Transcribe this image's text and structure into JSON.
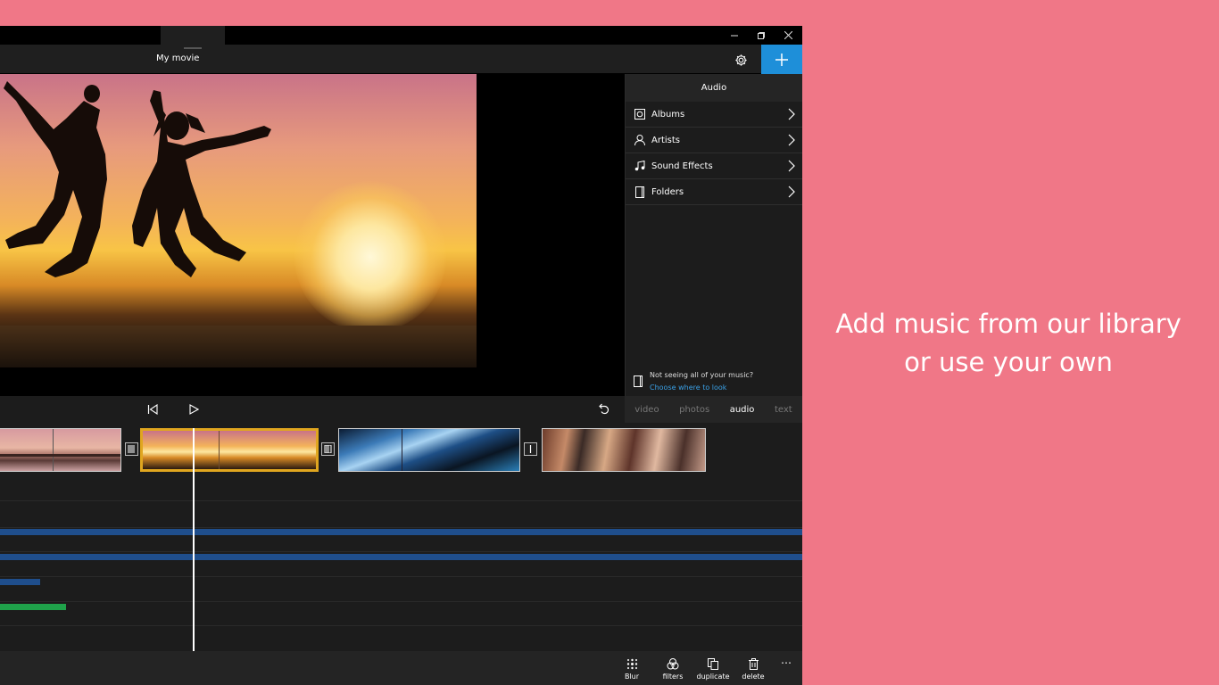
{
  "app": {
    "title": "My movie",
    "window_controls": [
      "minimize-icon",
      "restore-icon",
      "close-icon"
    ],
    "accent": "#1e8fd9"
  },
  "panel": {
    "title": "Audio",
    "items": [
      {
        "label": "Albums",
        "icon": "album-icon"
      },
      {
        "label": "Artists",
        "icon": "person-icon"
      },
      {
        "label": "Sound Effects",
        "icon": "music-note-icon"
      },
      {
        "label": "Folders",
        "icon": "folder-icon"
      }
    ],
    "not_seeing": "Not seeing all of your music?",
    "choose_link": "Choose where to look"
  },
  "tabs": [
    {
      "label": "video",
      "active": false
    },
    {
      "label": "photos",
      "active": false
    },
    {
      "label": "audio",
      "active": true
    },
    {
      "label": "text",
      "active": false
    }
  ],
  "toolbar": {
    "blur": "Blur",
    "filters": "filters",
    "duplicate": "duplicate",
    "delete": "delete",
    "more": "⋯"
  },
  "caption": {
    "line1": "Add music from our library",
    "line2": "or use your own"
  },
  "colors": {
    "background": "#f07787",
    "selected_clip": "#e0a61f",
    "audio_track": "#1f4e8c",
    "text_track": "#1fa24a"
  }
}
